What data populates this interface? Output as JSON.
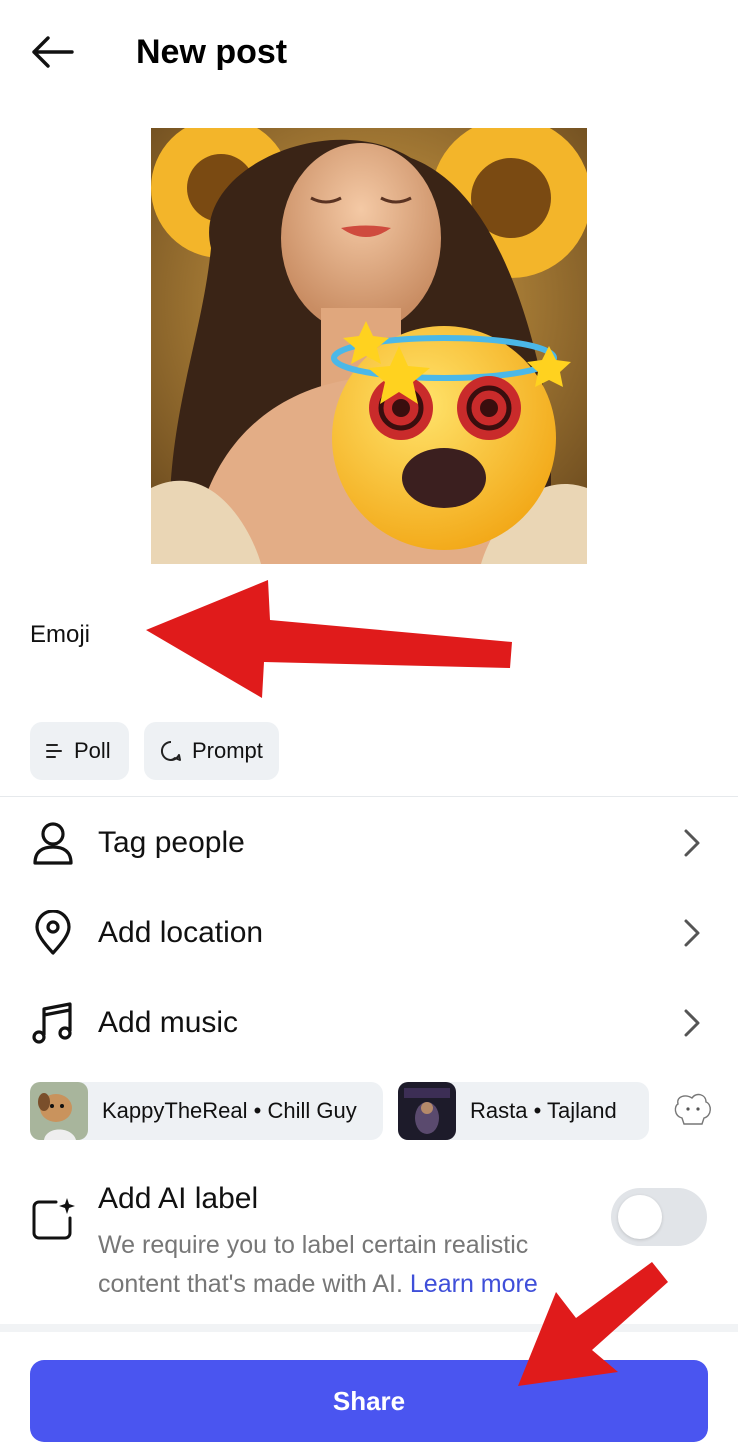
{
  "header": {
    "title": "New post",
    "back_icon": "arrow-left-icon"
  },
  "caption": {
    "text": "Emoji"
  },
  "chips": [
    {
      "label": "Poll",
      "icon": "list-icon"
    },
    {
      "label": "Prompt",
      "icon": "chat-bubble-icon"
    }
  ],
  "options": [
    {
      "label": "Tag people",
      "icon": "person-icon"
    },
    {
      "label": "Add location",
      "icon": "location-pin-icon"
    },
    {
      "label": "Add music",
      "icon": "music-note-icon"
    }
  ],
  "music_suggestions": [
    {
      "label": "KappyTheReal • Chill Guy"
    },
    {
      "label": "Rasta • Tajland"
    }
  ],
  "ai_label": {
    "title": "Add AI label",
    "description": "We require you to label certain realistic content that's made with AI.",
    "link": "Learn more",
    "enabled": false
  },
  "share": {
    "label": "Share"
  },
  "colors": {
    "accent": "#4a55f0",
    "chip_bg": "#eef1f4",
    "link": "#3f4fd9",
    "annotation_arrow": "#e01b1b"
  }
}
